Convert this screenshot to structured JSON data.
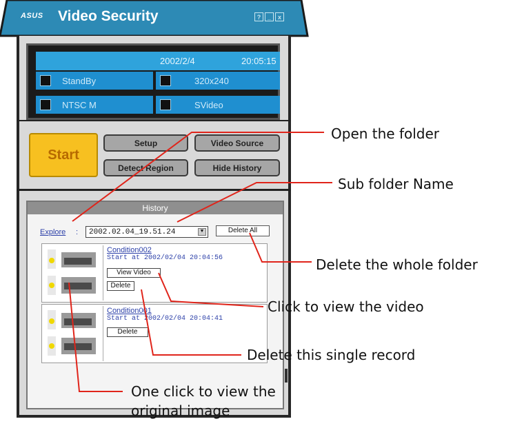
{
  "window": {
    "logo": "ASUS",
    "title": "Video Security",
    "controls": [
      "?",
      "_",
      "x"
    ]
  },
  "status": {
    "date": "2002/2/4",
    "time": "20:05:15",
    "state": "StandBy",
    "resolution": "320x240",
    "standard": "NTSC M",
    "source": "SVideo"
  },
  "buttons": {
    "start": "Start",
    "setup": "Setup",
    "video_source": "Video Source",
    "detect_region": "Detect Region",
    "hide_history": "Hide History"
  },
  "history": {
    "title": "History",
    "explore": "Explore",
    "folder": "2002.02.04_19.51.24",
    "delete_all": "Delete All",
    "records": [
      {
        "name": "Condition002",
        "start": "Start at 2002/02/04 20:04:56",
        "view": "View Video",
        "delete": "Delete"
      },
      {
        "name": "Condition001",
        "start": "Start at 2002/02/04 20:04:41",
        "delete": "Delete"
      }
    ]
  },
  "annotations": {
    "open_folder": "Open the folder",
    "sub_folder": "Sub folder Name",
    "delete_folder": "Delete the whole folder",
    "view_video": "Click to view the video",
    "delete_record": "Delete this single record",
    "view_image_1": "One click to view the",
    "view_image_2": "original image"
  },
  "colors": {
    "titlebar": "#2d8ab5",
    "status_blue": "#1f8fd0",
    "start_yellow": "#f7c020",
    "callout_line": "#e0241a"
  }
}
